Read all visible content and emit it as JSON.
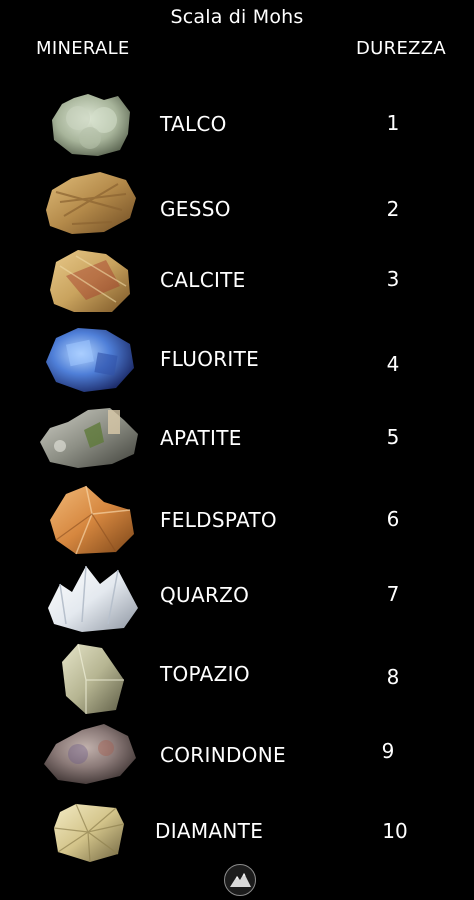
{
  "title": "Scala di Mohs",
  "headers": {
    "mineral": "MINERALE",
    "hardness": "DUREZZA"
  },
  "minerals": [
    {
      "name": "TALCO",
      "hardness": "1",
      "icon": "talc-crystal-icon",
      "color": "#a7b49a"
    },
    {
      "name": "GESSO",
      "hardness": "2",
      "icon": "gypsum-crystal-icon",
      "color": "#b48a4a"
    },
    {
      "name": "CALCITE",
      "hardness": "3",
      "icon": "calcite-crystal-icon",
      "color": "#c9a35e"
    },
    {
      "name": "FLUORITE",
      "hardness": "4",
      "icon": "fluorite-crystal-icon",
      "color": "#4f7fd8"
    },
    {
      "name": "APATITE",
      "hardness": "5",
      "icon": "apatite-crystal-icon",
      "color": "#8d8f85"
    },
    {
      "name": "FELDSPATO",
      "hardness": "6",
      "icon": "feldspar-crystal-icon",
      "color": "#d6873f"
    },
    {
      "name": "QUARZO",
      "hardness": "7",
      "icon": "quartz-crystal-icon",
      "color": "#e4e9ef"
    },
    {
      "name": "TOPAZIO",
      "hardness": "8",
      "icon": "topaz-crystal-icon",
      "color": "#b6b592"
    },
    {
      "name": "CORINDONE",
      "hardness": "9",
      "icon": "corundum-crystal-icon",
      "color": "#8b7a78"
    },
    {
      "name": "DIAMANTE",
      "hardness": "10",
      "icon": "diamond-crystal-icon",
      "color": "#d3c48a"
    }
  ],
  "footer": {
    "icon": "mountain-logo-icon"
  }
}
